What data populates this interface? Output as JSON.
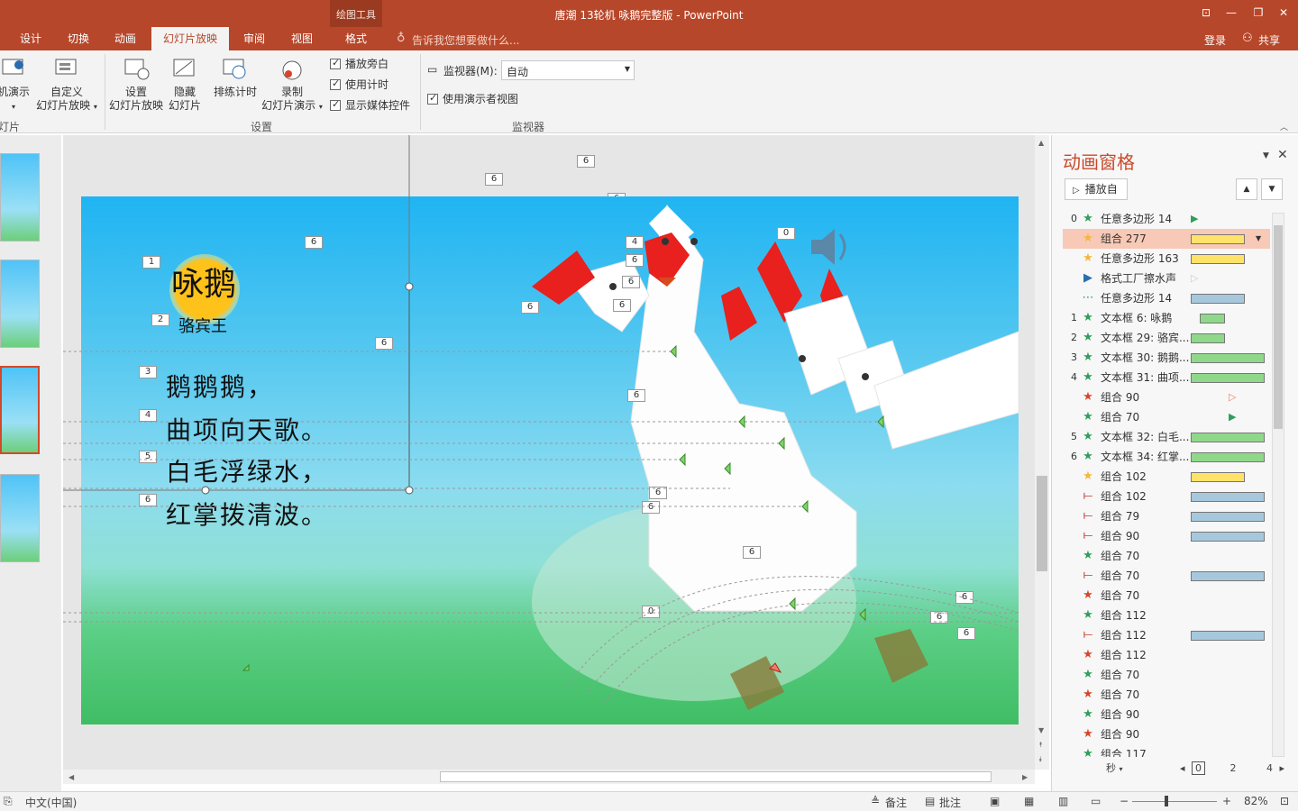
{
  "window": {
    "title": "唐潮 13轮机 咏鹅完整版 - PowerPoint",
    "context_group": "绘图工具",
    "controls": {
      "ribbon_opts": "⊡",
      "minimize": "—",
      "restore": "❐",
      "close": "✕"
    }
  },
  "tabs": [
    {
      "label": "设计"
    },
    {
      "label": "切换"
    },
    {
      "label": "动画"
    },
    {
      "label": "幻灯片放映",
      "active": true
    },
    {
      "label": "审阅"
    },
    {
      "label": "视图"
    },
    {
      "label": "格式"
    }
  ],
  "tell_me": "告诉我您想要做什么...",
  "account": {
    "login": "登录",
    "share": "共享"
  },
  "ribbon": {
    "btn_online": "机演示",
    "btn_custom_1": "自定义",
    "btn_custom_2": "幻灯片放映",
    "group_start": "灯片",
    "btn_setup_1": "设置",
    "btn_setup_2": "幻灯片放映",
    "btn_hide_1": "隐藏",
    "btn_hide_2": "幻灯片",
    "btn_rehearse": "排练计时",
    "btn_record_1": "录制",
    "btn_record_2": "幻灯片演示",
    "chk_narration": "播放旁白",
    "chk_timing": "使用计时",
    "chk_media": "显示媒体控件",
    "group_setup": "设置",
    "monitor_label": "监视器(M):",
    "monitor_value": "自动",
    "chk_presenter": "使用演示者视图",
    "group_monitor": "监视器"
  },
  "slide": {
    "title": "咏鹅",
    "author": "骆宾王",
    "lines": [
      "鹅鹅鹅，",
      "曲项向天歌。",
      "白毛浮绿水，",
      "红掌拨清波。"
    ],
    "tags": {
      "t1": "1",
      "t2": "2",
      "t3": "3",
      "t4": "4",
      "t5": "5",
      "t6": "6",
      "t0": "0"
    }
  },
  "anim_pane": {
    "title": "动画窗格",
    "play_from": "播放自",
    "items": [
      {
        "num": "0",
        "icon": "star",
        "name": "任意多边形 14",
        "color": "#2e9f5a"
      },
      {
        "num": "",
        "icon": "star",
        "name": "组合 277",
        "color": "#f5b63b",
        "selected": true
      },
      {
        "num": "",
        "icon": "star",
        "name": "任意多边形 163",
        "color": "#f5b63b"
      },
      {
        "num": "",
        "icon": "play",
        "name": "格式工厂擦水声",
        "color": "#2b6cb0"
      },
      {
        "num": "",
        "icon": "path",
        "name": "任意多边形 14",
        "color": "#2e9f5a"
      },
      {
        "num": "1",
        "icon": "star",
        "name": "文本框 6: 咏鹅",
        "color": "#2e9f5a"
      },
      {
        "num": "2",
        "icon": "star",
        "name": "文本框 29: 骆宾...",
        "color": "#2e9f5a"
      },
      {
        "num": "3",
        "icon": "star",
        "name": "文本框 30: 鹅鹅...",
        "color": "#2e9f5a"
      },
      {
        "num": "4",
        "icon": "star",
        "name": "文本框 31: 曲项...",
        "color": "#2e9f5a"
      },
      {
        "num": "",
        "icon": "star",
        "name": "组合 90",
        "color": "#d9452b"
      },
      {
        "num": "",
        "icon": "star",
        "name": "组合 70",
        "color": "#2e9f5a"
      },
      {
        "num": "5",
        "icon": "star",
        "name": "文本框 32: 白毛...",
        "color": "#2e9f5a"
      },
      {
        "num": "6",
        "icon": "star",
        "name": "文本框 34: 红掌...",
        "color": "#2e9f5a"
      },
      {
        "num": "",
        "icon": "star",
        "name": "组合 102",
        "color": "#f5b63b"
      },
      {
        "num": "",
        "icon": "line",
        "name": "组合 102",
        "color": "#c0392b"
      },
      {
        "num": "",
        "icon": "line",
        "name": "组合 79",
        "color": "#c0392b"
      },
      {
        "num": "",
        "icon": "line",
        "name": "组合 90",
        "color": "#c0392b"
      },
      {
        "num": "",
        "icon": "star",
        "name": "组合 70",
        "color": "#2e9f5a"
      },
      {
        "num": "",
        "icon": "line",
        "name": "组合 70",
        "color": "#c0392b"
      },
      {
        "num": "",
        "icon": "star",
        "name": "组合 70",
        "color": "#d9452b"
      },
      {
        "num": "",
        "icon": "star",
        "name": "组合 112",
        "color": "#2e9f5a"
      },
      {
        "num": "",
        "icon": "line",
        "name": "组合 112",
        "color": "#c0392b"
      },
      {
        "num": "",
        "icon": "star",
        "name": "组合 112",
        "color": "#d9452b"
      },
      {
        "num": "",
        "icon": "star",
        "name": "组合 70",
        "color": "#2e9f5a"
      },
      {
        "num": "",
        "icon": "star",
        "name": "组合 70",
        "color": "#d9452b"
      },
      {
        "num": "",
        "icon": "star",
        "name": "组合 90",
        "color": "#2e9f5a"
      },
      {
        "num": "",
        "icon": "star",
        "name": "组合 90",
        "color": "#d9452b"
      },
      {
        "num": "",
        "icon": "star",
        "name": "组合 117",
        "color": "#2e9f5a"
      }
    ],
    "timeline": {
      "unit": "秒",
      "t0": "0",
      "t2": "2",
      "t4": "4"
    }
  },
  "statusbar": {
    "language": "中文(中国)",
    "notes": "备注",
    "comments": "批注",
    "zoom": "82%"
  },
  "colors": {
    "accent": "#b7472a",
    "pane_title": "#c94a2a",
    "green_bar": "#8fd88a",
    "blue_bar": "#a7c8dc",
    "yellow_bar": "#ffe26a"
  }
}
